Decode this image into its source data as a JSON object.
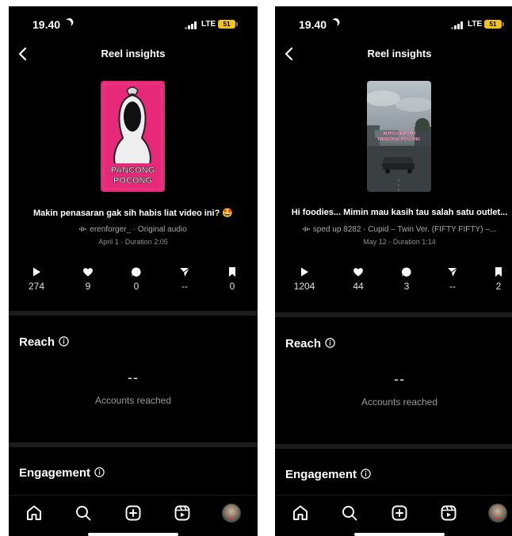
{
  "screens": [
    {
      "status": {
        "time": "19.40",
        "network": "LTE",
        "battery": "51"
      },
      "header": {
        "title": "Reel insights"
      },
      "reel": {
        "thumbnail_text_line1": "PANCONG",
        "thumbnail_text_line2": "POCONG",
        "caption": "Makin penasaran gak sih habis liat video ini? 🤩",
        "audio": "erenforger_ · Original audio",
        "meta": "April 1 · Duration 2:05"
      },
      "stats": {
        "plays": "274",
        "likes": "9",
        "comments": "0",
        "shares": "--",
        "saves": "0"
      },
      "reach": {
        "title": "Reach",
        "value": "--",
        "label": "Accounts reached"
      },
      "engagement": {
        "title": "Engagement"
      }
    },
    {
      "status": {
        "time": "19.40",
        "network": "LTE",
        "battery": "51"
      },
      "header": {
        "title": "Reel insights"
      },
      "reel": {
        "thumbnail_text_line1": "AUTO MEROTU",
        "thumbnail_text_line2": "PANCONG POCONG",
        "caption": "Hi foodies... Mimin mau kasih tau salah satu outlet...",
        "audio": "sped up 8282 · Cupid – Twin Ver. (FIFTY FIFTY) –...",
        "meta": "May 12 · Duration 1:14"
      },
      "stats": {
        "plays": "1204",
        "likes": "44",
        "comments": "3",
        "shares": "--",
        "saves": "2"
      },
      "reach": {
        "title": "Reach",
        "value": "--",
        "label": "Accounts reached"
      },
      "engagement": {
        "title": "Engagement"
      }
    }
  ],
  "colors": {
    "background": "#000000",
    "divider": "#1c1c1c",
    "battery": "#f2c318",
    "thumb_pink": "#e8297a",
    "notification_dot": "#ff3040"
  },
  "icons": [
    "back-chevron-icon",
    "play-icon",
    "heart-icon",
    "comment-icon",
    "share-icon",
    "bookmark-icon",
    "info-icon",
    "home-icon",
    "search-icon",
    "create-icon",
    "reels-icon",
    "profile-avatar"
  ]
}
